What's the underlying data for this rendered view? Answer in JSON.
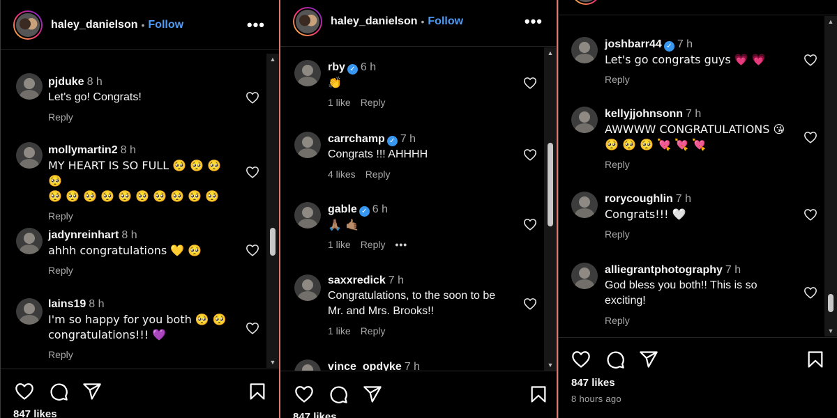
{
  "post": {
    "username": "haley_danielson",
    "follow_label": "Follow",
    "separator": "•",
    "more_label": "•••",
    "likes": "847 likes",
    "time_ago": "8 hours ago"
  },
  "panel1": {
    "comments": [
      {
        "user": "pjduke",
        "time": "8 h",
        "text": "Let's go! Congrats!",
        "meta": [
          "Reply"
        ]
      },
      {
        "user": "mollymartin2",
        "time": "8 h",
        "text": "MY HEART IS SO FULL 🥺 🥺 🥺 🥺\n🥺 🥺 🥺 🥺 🥺 🥺 🥺 🥺 🥺 🥺",
        "meta": [
          "Reply"
        ]
      },
      {
        "user": "jadynreinhart",
        "time": "8 h",
        "text": "ahhh congratulations 💛 🥺",
        "meta": [
          "Reply"
        ]
      },
      {
        "user": "lains19",
        "time": "8 h",
        "text": "I'm so happy for you both 🥺 🥺\ncongratulations!!! 💜",
        "meta": [
          "Reply"
        ]
      }
    ]
  },
  "panel2": {
    "comments": [
      {
        "user": "rby",
        "verified": true,
        "time": "6 h",
        "text": "👏",
        "meta": [
          "1 like",
          "Reply"
        ]
      },
      {
        "user": "carrchamp",
        "verified": true,
        "time": "7 h",
        "text": "Congrats !!! AHHHH",
        "meta": [
          "4 likes",
          "Reply"
        ]
      },
      {
        "user": "gable",
        "verified": true,
        "time": "6 h",
        "text": "🙏🏽 🤙🏽",
        "meta": [
          "1 like",
          "Reply",
          "•••"
        ]
      },
      {
        "user": "saxxredick",
        "time": "7 h",
        "text": "Congratulations, to the soon to be\nMr. and Mrs. Brooks!!",
        "meta": [
          "1 like",
          "Reply"
        ]
      },
      {
        "user": "vince_opdyke",
        "time": "7 h",
        "text": "",
        "meta": []
      }
    ]
  },
  "panel3": {
    "comments": [
      {
        "user": "joshbarr44",
        "verified": true,
        "time": "7 h",
        "text": "Let's go congrats guys 💗 💗",
        "meta": [
          "Reply"
        ]
      },
      {
        "user": "kellyjjohnsonn",
        "time": "7 h",
        "text": "AWWWW CONGRATULATIONS 😘\n🥺 🥺 🥺 💘 💘 💘",
        "meta": [
          "Reply"
        ]
      },
      {
        "user": "rorycoughlin",
        "time": "7 h",
        "text": "Congrats!!! 🤍",
        "meta": [
          "Reply"
        ]
      },
      {
        "user": "alliegrantphotography",
        "time": "7 h",
        "text": "God bless you both!! This is so\nexciting!",
        "meta": [
          "Reply"
        ]
      }
    ]
  },
  "colors": {
    "background": "#000000",
    "follow_blue": "#4f9bf5",
    "verified_blue": "#3897f0",
    "muted_text": "#a8a8a8",
    "panel_highlight_border": "#e0766e"
  },
  "icons": [
    "heart-icon",
    "comment-icon",
    "share-icon",
    "bookmark-icon",
    "more-icon",
    "verified-icon"
  ]
}
